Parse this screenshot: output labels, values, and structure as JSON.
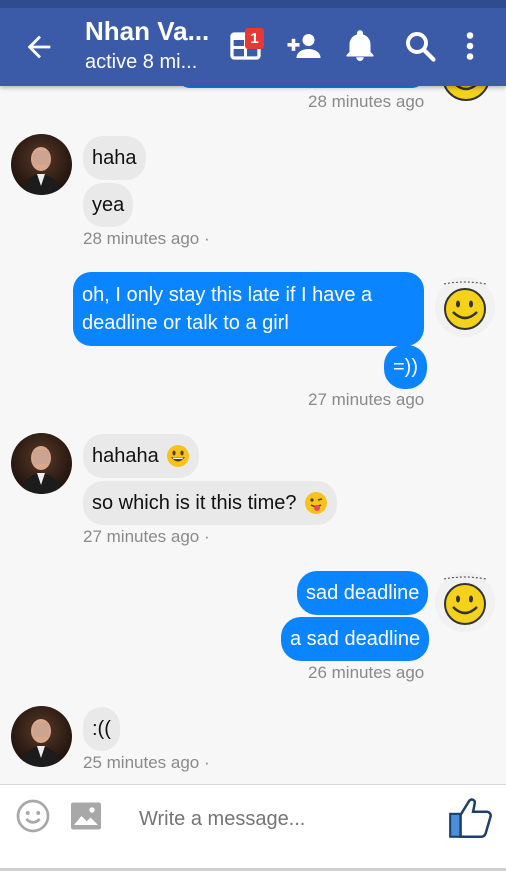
{
  "header": {
    "title": "Nhan Va...",
    "subtitle": "active 8 mi...",
    "badge_count": "1",
    "bg_color": "#3b5ba8",
    "icons": [
      "back-arrow-icon",
      "calendar-icon",
      "add-person-icon",
      "bell-icon",
      "search-icon",
      "more-vert-icon"
    ]
  },
  "messages": {
    "top_timestamp": "28 minutes ago",
    "group1": {
      "bubbles": [
        "haha",
        "yea"
      ],
      "timestamp": "28 minutes ago ·"
    },
    "group2": {
      "bubble1_line1": "oh, I only stay this late if I have a",
      "bubble1_line2": "deadline or talk to a girl",
      "bubble2": "=))",
      "timestamp": "27 minutes ago"
    },
    "group3": {
      "bubbles": [
        "hahaha",
        "so which is it this time?"
      ],
      "timestamp": "27 minutes ago ·"
    },
    "group4": {
      "bubbles": [
        "sad deadline",
        "a sad deadline"
      ],
      "timestamp": "26 minutes ago"
    },
    "group5": {
      "bubbles": [
        ":(("
      ],
      "timestamp": "25 minutes ago ·"
    },
    "outgoing_color": "#0a84ff",
    "incoming_color": "#e9e9e9"
  },
  "composer": {
    "placeholder": "Write a message...",
    "icons": [
      "emoji-icon",
      "image-icon",
      "thumbs-up-icon"
    ]
  }
}
